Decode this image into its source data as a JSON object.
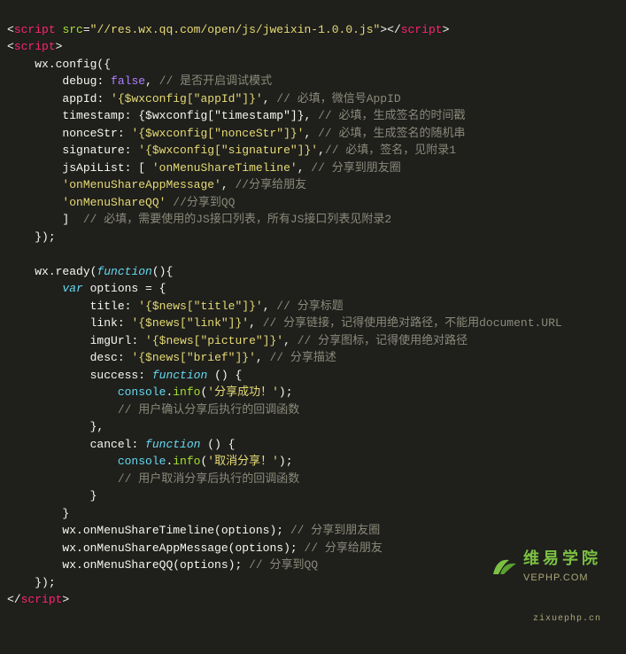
{
  "ext_script_src": "//res.wx.qq.com/open/js/jweixin-1.0.0.js",
  "pad2": "    ",
  "pad3": "        ",
  "pad4": "            ",
  "pad5": "                ",
  "cfg": {
    "open": "wx.config({",
    "debug_key": "debug",
    "debug_val": "false",
    "debug_com": "// 是否开启调试模式",
    "appId_key": "appId",
    "appId_val": "'{$wxconfig[\"appId\"]}'",
    "appId_com": "// 必填，微信号AppID",
    "ts_key": "timestamp",
    "ts_val": "{$wxconfig[\"timestamp\"]}",
    "ts_com": "// 必填，生成签名的时间戳",
    "nonce_key": "nonceStr",
    "nonce_val": "'{$wxconfig[\"nonceStr\"]}'",
    "nonce_com": "// 必填，生成签名的随机串",
    "sig_key": "signature",
    "sig_val": "'{$wxconfig[\"signature\"]}'",
    "sig_com": "// 必填，签名，见附录1",
    "jsApi_key": "jsApiList",
    "jsApi_v1": "'onMenuShareTimeline'",
    "jsApi_c1": "// 分享到朋友圈",
    "jsApi_v2": "'onMenuShareAppMessage'",
    "jsApi_c2": "//分享给朋友",
    "jsApi_v3": "'onMenuShareQQ'",
    "jsApi_c3": "//分享到QQ",
    "jsApi_close_com": "// 必填，需要使用的JS接口列表，所有JS接口列表见附录2",
    "close": "});"
  },
  "ready": {
    "open": "wx.ready(",
    "func_kw": "function",
    "options_decl_var": "var",
    "options_decl_name": " options = {",
    "title_key": "title",
    "title_val": "'{$news[\"title\"]}'",
    "title_com": "// 分享标题",
    "link_key": "link",
    "link_val": "'{$news[\"link\"]}'",
    "link_com": "// 分享链接，记得使用绝对路径，不能用document.URL",
    "img_key": "imgUrl",
    "img_val": "'{$news[\"picture\"]}'",
    "img_com": "// 分享图标，记得使用绝对路径",
    "desc_key": "desc",
    "desc_val": "'{$news[\"brief\"]}'",
    "desc_com": "// 分享描述",
    "success_key": "success",
    "success_msg": "'分享成功！'",
    "success_com": "// 用户确认分享后执行的回调函数",
    "cancel_key": "cancel",
    "cancel_msg": "'取消分享！'",
    "cancel_com": "// 用户取消分享后执行的回调函数",
    "console_obj": "console",
    "console_fn": "info",
    "call1": "wx.onMenuShareTimeline(options);",
    "call1_com": "// 分享到朋友圈",
    "call2": "wx.onMenuShareAppMessage(options);",
    "call2_com": "// 分享给朋友",
    "call3": "wx.onMenuShareQQ(options);",
    "call3_com": "// 分享到QQ"
  },
  "logo": {
    "cn": "维易学院",
    "en": "VEPHP.COM",
    "sub": "zixuephp.cn"
  }
}
